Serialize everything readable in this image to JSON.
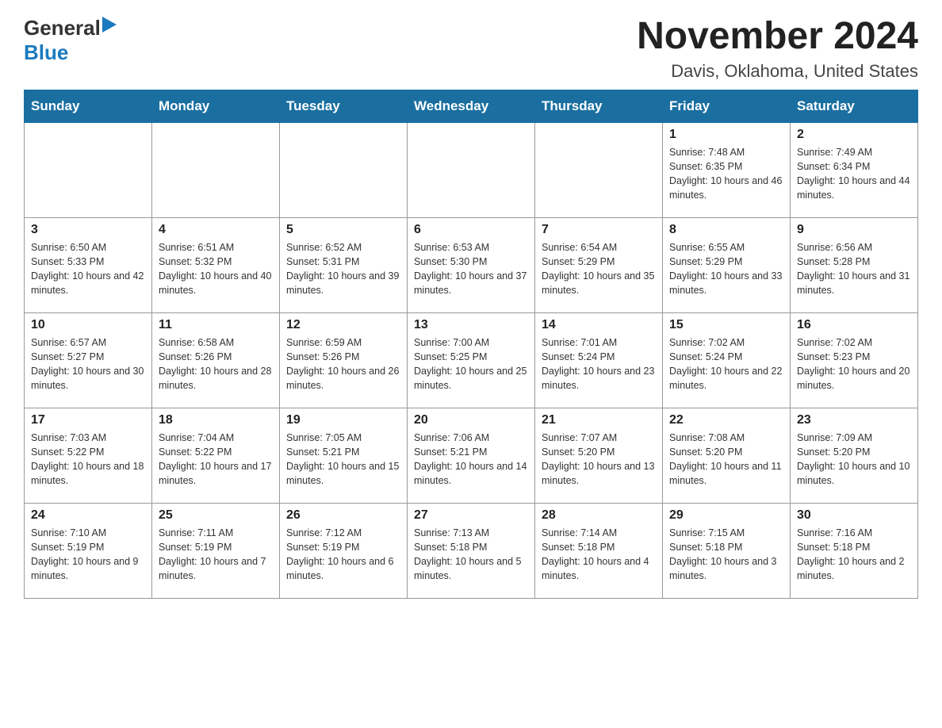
{
  "header": {
    "logo_general": "General",
    "logo_blue": "Blue",
    "month_year": "November 2024",
    "location": "Davis, Oklahoma, United States"
  },
  "weekdays": [
    "Sunday",
    "Monday",
    "Tuesday",
    "Wednesday",
    "Thursday",
    "Friday",
    "Saturday"
  ],
  "weeks": [
    [
      {
        "day": "",
        "info": ""
      },
      {
        "day": "",
        "info": ""
      },
      {
        "day": "",
        "info": ""
      },
      {
        "day": "",
        "info": ""
      },
      {
        "day": "",
        "info": ""
      },
      {
        "day": "1",
        "info": "Sunrise: 7:48 AM\nSunset: 6:35 PM\nDaylight: 10 hours and 46 minutes."
      },
      {
        "day": "2",
        "info": "Sunrise: 7:49 AM\nSunset: 6:34 PM\nDaylight: 10 hours and 44 minutes."
      }
    ],
    [
      {
        "day": "3",
        "info": "Sunrise: 6:50 AM\nSunset: 5:33 PM\nDaylight: 10 hours and 42 minutes."
      },
      {
        "day": "4",
        "info": "Sunrise: 6:51 AM\nSunset: 5:32 PM\nDaylight: 10 hours and 40 minutes."
      },
      {
        "day": "5",
        "info": "Sunrise: 6:52 AM\nSunset: 5:31 PM\nDaylight: 10 hours and 39 minutes."
      },
      {
        "day": "6",
        "info": "Sunrise: 6:53 AM\nSunset: 5:30 PM\nDaylight: 10 hours and 37 minutes."
      },
      {
        "day": "7",
        "info": "Sunrise: 6:54 AM\nSunset: 5:29 PM\nDaylight: 10 hours and 35 minutes."
      },
      {
        "day": "8",
        "info": "Sunrise: 6:55 AM\nSunset: 5:29 PM\nDaylight: 10 hours and 33 minutes."
      },
      {
        "day": "9",
        "info": "Sunrise: 6:56 AM\nSunset: 5:28 PM\nDaylight: 10 hours and 31 minutes."
      }
    ],
    [
      {
        "day": "10",
        "info": "Sunrise: 6:57 AM\nSunset: 5:27 PM\nDaylight: 10 hours and 30 minutes."
      },
      {
        "day": "11",
        "info": "Sunrise: 6:58 AM\nSunset: 5:26 PM\nDaylight: 10 hours and 28 minutes."
      },
      {
        "day": "12",
        "info": "Sunrise: 6:59 AM\nSunset: 5:26 PM\nDaylight: 10 hours and 26 minutes."
      },
      {
        "day": "13",
        "info": "Sunrise: 7:00 AM\nSunset: 5:25 PM\nDaylight: 10 hours and 25 minutes."
      },
      {
        "day": "14",
        "info": "Sunrise: 7:01 AM\nSunset: 5:24 PM\nDaylight: 10 hours and 23 minutes."
      },
      {
        "day": "15",
        "info": "Sunrise: 7:02 AM\nSunset: 5:24 PM\nDaylight: 10 hours and 22 minutes."
      },
      {
        "day": "16",
        "info": "Sunrise: 7:02 AM\nSunset: 5:23 PM\nDaylight: 10 hours and 20 minutes."
      }
    ],
    [
      {
        "day": "17",
        "info": "Sunrise: 7:03 AM\nSunset: 5:22 PM\nDaylight: 10 hours and 18 minutes."
      },
      {
        "day": "18",
        "info": "Sunrise: 7:04 AM\nSunset: 5:22 PM\nDaylight: 10 hours and 17 minutes."
      },
      {
        "day": "19",
        "info": "Sunrise: 7:05 AM\nSunset: 5:21 PM\nDaylight: 10 hours and 15 minutes."
      },
      {
        "day": "20",
        "info": "Sunrise: 7:06 AM\nSunset: 5:21 PM\nDaylight: 10 hours and 14 minutes."
      },
      {
        "day": "21",
        "info": "Sunrise: 7:07 AM\nSunset: 5:20 PM\nDaylight: 10 hours and 13 minutes."
      },
      {
        "day": "22",
        "info": "Sunrise: 7:08 AM\nSunset: 5:20 PM\nDaylight: 10 hours and 11 minutes."
      },
      {
        "day": "23",
        "info": "Sunrise: 7:09 AM\nSunset: 5:20 PM\nDaylight: 10 hours and 10 minutes."
      }
    ],
    [
      {
        "day": "24",
        "info": "Sunrise: 7:10 AM\nSunset: 5:19 PM\nDaylight: 10 hours and 9 minutes."
      },
      {
        "day": "25",
        "info": "Sunrise: 7:11 AM\nSunset: 5:19 PM\nDaylight: 10 hours and 7 minutes."
      },
      {
        "day": "26",
        "info": "Sunrise: 7:12 AM\nSunset: 5:19 PM\nDaylight: 10 hours and 6 minutes."
      },
      {
        "day": "27",
        "info": "Sunrise: 7:13 AM\nSunset: 5:18 PM\nDaylight: 10 hours and 5 minutes."
      },
      {
        "day": "28",
        "info": "Sunrise: 7:14 AM\nSunset: 5:18 PM\nDaylight: 10 hours and 4 minutes."
      },
      {
        "day": "29",
        "info": "Sunrise: 7:15 AM\nSunset: 5:18 PM\nDaylight: 10 hours and 3 minutes."
      },
      {
        "day": "30",
        "info": "Sunrise: 7:16 AM\nSunset: 5:18 PM\nDaylight: 10 hours and 2 minutes."
      }
    ]
  ]
}
